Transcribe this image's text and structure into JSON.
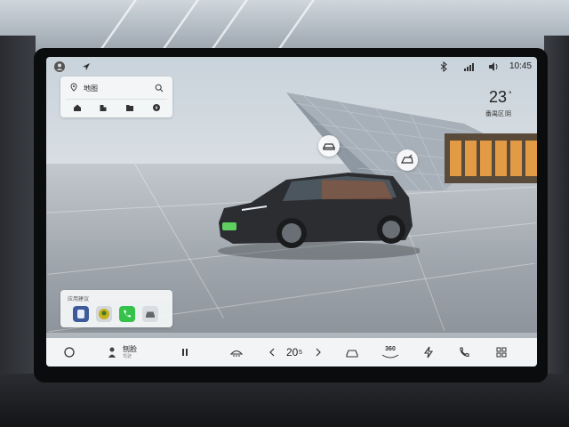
{
  "status_bar": {
    "icons": [
      "avatar-icon",
      "navigation-arrow-icon",
      "bluetooth-icon",
      "signal-icon",
      "volume-icon"
    ],
    "time": "10:45"
  },
  "weather": {
    "temperature": "23",
    "unit": "°",
    "location": "番禺区",
    "condition": "阴"
  },
  "map_card": {
    "title": "地图",
    "icons": [
      "map-icon",
      "search-icon",
      "home-icon",
      "company-icon",
      "favorites-icon",
      "charging-icon"
    ]
  },
  "vehicle_scene": {
    "hotspots": [
      "car-front-hotspot",
      "car-trunk-hotspot"
    ]
  },
  "app_suggestions": {
    "title": "应用建议",
    "apps": [
      "app-blue-icon",
      "app-yellow-icon",
      "phone-app-icon",
      "car-app-icon"
    ]
  },
  "dock": {
    "driver_name": "刨脸",
    "driver_sub": "驾驶",
    "temperature_whole": "20",
    "temperature_decimal": "5",
    "icons": [
      "circle-home-icon",
      "driver-avatar-icon",
      "pause-icon",
      "defrost-icon",
      "chevron-left-icon",
      "chevron-right-icon",
      "car-icon",
      "360-camera-icon",
      "energy-icon",
      "phone-icon",
      "apps-grid-icon"
    ],
    "label_360": "360"
  },
  "colors": {
    "accent_green": "#34c24a",
    "garage_orange": "#e39a45"
  }
}
